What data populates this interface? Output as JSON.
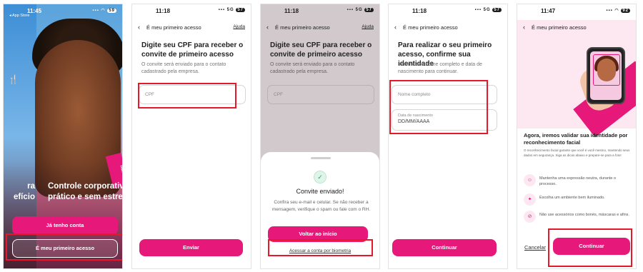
{
  "screen1": {
    "time": "11:45",
    "back_app": "◂ App Store",
    "signal": "▪▪▪ ◠",
    "battery": "59",
    "left_caption": "ra\nefício",
    "brand_tag": "flash",
    "caption": "Controle corporativo prático e sem estre",
    "primary_button": "Já tenho conta",
    "secondary_button": "É meu primeiro acesso"
  },
  "screen2": {
    "time": "11:18",
    "network": "5G",
    "battery": "57",
    "nav_title": "É meu primeiro acesso",
    "help": "Ajuda",
    "heading": "Digite seu CPF para receber o convite de primeiro acesso",
    "description": "O convite será enviado para o contato cadastrado pela empresa.",
    "cpf_placeholder": "CPF",
    "send_button": "Enviar"
  },
  "screen3": {
    "time": "11:18",
    "network": "5G",
    "battery": "57",
    "nav_title": "É meu primeiro acesso",
    "help": "Ajuda",
    "heading": "Digite seu CPF para receber o convite de primeiro acesso",
    "description": "O convite será enviado para o contato cadastrado pela empresa.",
    "cpf_placeholder": "CPF",
    "sheet_title": "Convite enviado!",
    "sheet_text": "Confira seu e-mail e celular. Se não receber a mensagem, verifique o spam ou fale com o RH.",
    "back_button": "Voltar ao início",
    "biometrics_link": "Acessar a conta por biometria"
  },
  "screen4": {
    "time": "11:18",
    "network": "5G",
    "battery": "57",
    "nav_title": "É meu primeiro acesso",
    "heading": "Para realizar o seu primeiro acesso, confirme sua identidade",
    "description": "Informe seu nome completo e data de nascimento para continuar.",
    "name_placeholder": "Nome completo",
    "birth_label": "Data de nascimento",
    "birth_placeholder": "DD/MM/AAAA",
    "continue_button": "Continuar"
  },
  "screen5": {
    "time": "11:47",
    "battery": "92",
    "nav_title": "É meu primeiro acesso",
    "heading": "Agora, iremos validar sua identidade por reconhecimento facial",
    "description": "O reconhecimento facial garante que você é você mesmo, mantendo seus dados em segurança. Siga as dicas abaixo e prepare-se para a foto!",
    "tips": [
      {
        "icon": "expression-icon",
        "glyph": "☺",
        "text": "Mantenha uma expressão neutra, durante o processo."
      },
      {
        "icon": "lightbulb-icon",
        "glyph": "✦",
        "text": "Escolha um ambiente bem iluminado."
      },
      {
        "icon": "no-accessories-icon",
        "glyph": "⊘",
        "text": "Não use acessórios como bonés, máscaras e afins."
      }
    ],
    "cancel": "Cancelar",
    "continue_button": "Continuar"
  },
  "colors": {
    "brand_pink": "#e6197a",
    "highlight_red": "#e6192b"
  }
}
